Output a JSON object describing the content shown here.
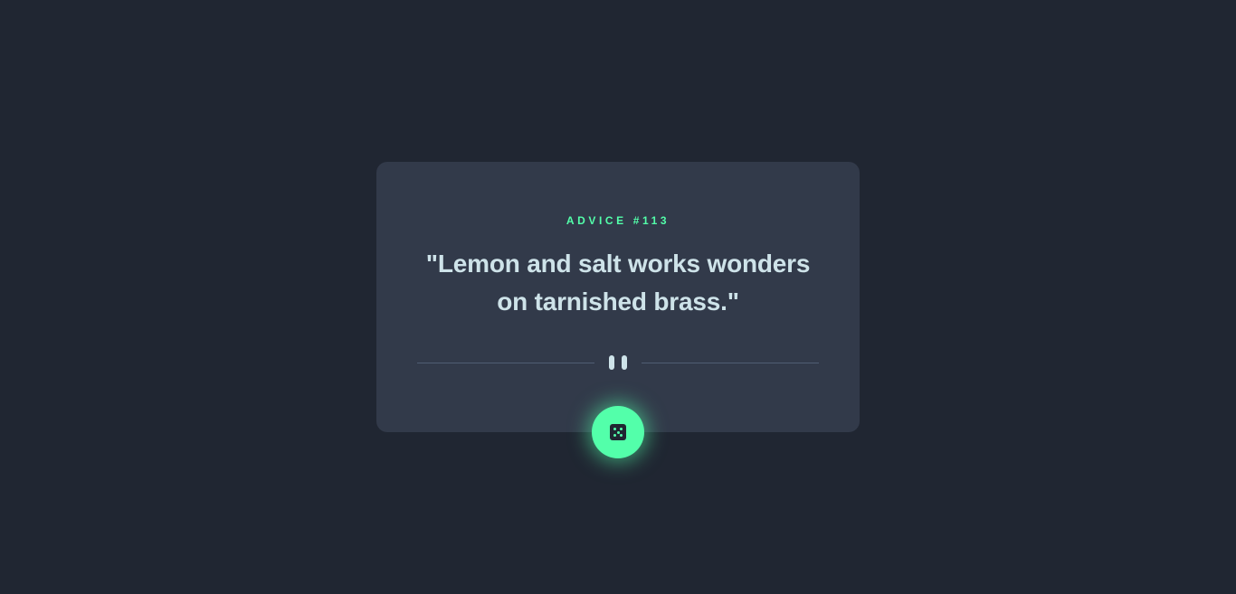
{
  "advice": {
    "id_label": "ADVICE #113",
    "text": "\"Lemon and salt works wonders on tarnished brass.\""
  },
  "button": {
    "icon": "dice-icon"
  },
  "colors": {
    "background": "#202632",
    "card": "#323a4a",
    "accent": "#53ffaa",
    "text": "#cee3e9",
    "divider": "#4f5d74"
  }
}
